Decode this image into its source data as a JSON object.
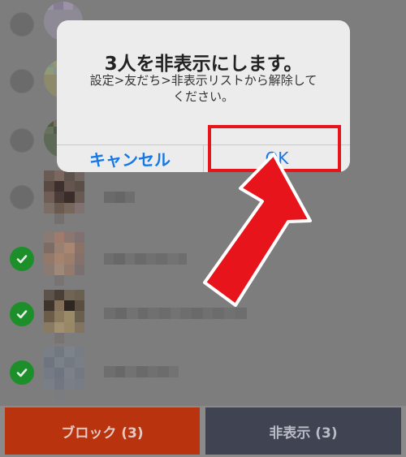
{
  "alert": {
    "title": "3人を非表示にします。",
    "message_line1": "設定>友だち>非表示リストから解除して",
    "message_line2": "ください。",
    "cancel_label": "キャンセル",
    "ok_label": "OK"
  },
  "actions": {
    "block_label": "ブロック (3)",
    "hide_label": "非表示 (3)"
  },
  "friends": [
    {
      "selected": false
    },
    {
      "selected": false
    },
    {
      "selected": false
    },
    {
      "selected": false
    },
    {
      "selected": true
    },
    {
      "selected": true
    },
    {
      "selected": true
    }
  ],
  "colors": {
    "accent_blue": "#1677e6",
    "highlight_red": "#e8141b",
    "block_button": "#b8330e",
    "hide_button": "#3f4352",
    "check_green": "#1d8f2a"
  },
  "icons": [
    "checkmark-icon",
    "red-arrow-annotation"
  ]
}
